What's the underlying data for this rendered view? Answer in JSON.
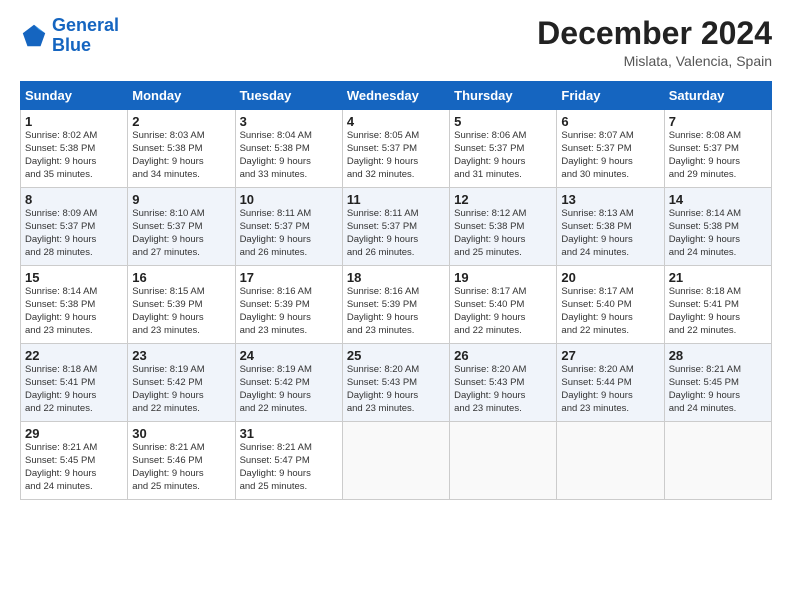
{
  "header": {
    "logo_line1": "General",
    "logo_line2": "Blue",
    "month_title": "December 2024",
    "location": "Mislata, Valencia, Spain"
  },
  "calendar": {
    "days_of_week": [
      "Sunday",
      "Monday",
      "Tuesday",
      "Wednesday",
      "Thursday",
      "Friday",
      "Saturday"
    ],
    "weeks": [
      [
        {
          "day": "",
          "info": ""
        },
        {
          "day": "2",
          "info": "Sunrise: 8:03 AM\nSunset: 5:38 PM\nDaylight: 9 hours\nand 34 minutes."
        },
        {
          "day": "3",
          "info": "Sunrise: 8:04 AM\nSunset: 5:38 PM\nDaylight: 9 hours\nand 33 minutes."
        },
        {
          "day": "4",
          "info": "Sunrise: 8:05 AM\nSunset: 5:37 PM\nDaylight: 9 hours\nand 32 minutes."
        },
        {
          "day": "5",
          "info": "Sunrise: 8:06 AM\nSunset: 5:37 PM\nDaylight: 9 hours\nand 31 minutes."
        },
        {
          "day": "6",
          "info": "Sunrise: 8:07 AM\nSunset: 5:37 PM\nDaylight: 9 hours\nand 30 minutes."
        },
        {
          "day": "7",
          "info": "Sunrise: 8:08 AM\nSunset: 5:37 PM\nDaylight: 9 hours\nand 29 minutes."
        }
      ],
      [
        {
          "day": "8",
          "info": "Sunrise: 8:09 AM\nSunset: 5:37 PM\nDaylight: 9 hours\nand 28 minutes."
        },
        {
          "day": "9",
          "info": "Sunrise: 8:10 AM\nSunset: 5:37 PM\nDaylight: 9 hours\nand 27 minutes."
        },
        {
          "day": "10",
          "info": "Sunrise: 8:11 AM\nSunset: 5:37 PM\nDaylight: 9 hours\nand 26 minutes."
        },
        {
          "day": "11",
          "info": "Sunrise: 8:11 AM\nSunset: 5:37 PM\nDaylight: 9 hours\nand 26 minutes."
        },
        {
          "day": "12",
          "info": "Sunrise: 8:12 AM\nSunset: 5:38 PM\nDaylight: 9 hours\nand 25 minutes."
        },
        {
          "day": "13",
          "info": "Sunrise: 8:13 AM\nSunset: 5:38 PM\nDaylight: 9 hours\nand 24 minutes."
        },
        {
          "day": "14",
          "info": "Sunrise: 8:14 AM\nSunset: 5:38 PM\nDaylight: 9 hours\nand 24 minutes."
        }
      ],
      [
        {
          "day": "15",
          "info": "Sunrise: 8:14 AM\nSunset: 5:38 PM\nDaylight: 9 hours\nand 23 minutes."
        },
        {
          "day": "16",
          "info": "Sunrise: 8:15 AM\nSunset: 5:39 PM\nDaylight: 9 hours\nand 23 minutes."
        },
        {
          "day": "17",
          "info": "Sunrise: 8:16 AM\nSunset: 5:39 PM\nDaylight: 9 hours\nand 23 minutes."
        },
        {
          "day": "18",
          "info": "Sunrise: 8:16 AM\nSunset: 5:39 PM\nDaylight: 9 hours\nand 23 minutes."
        },
        {
          "day": "19",
          "info": "Sunrise: 8:17 AM\nSunset: 5:40 PM\nDaylight: 9 hours\nand 22 minutes."
        },
        {
          "day": "20",
          "info": "Sunrise: 8:17 AM\nSunset: 5:40 PM\nDaylight: 9 hours\nand 22 minutes."
        },
        {
          "day": "21",
          "info": "Sunrise: 8:18 AM\nSunset: 5:41 PM\nDaylight: 9 hours\nand 22 minutes."
        }
      ],
      [
        {
          "day": "22",
          "info": "Sunrise: 8:18 AM\nSunset: 5:41 PM\nDaylight: 9 hours\nand 22 minutes."
        },
        {
          "day": "23",
          "info": "Sunrise: 8:19 AM\nSunset: 5:42 PM\nDaylight: 9 hours\nand 22 minutes."
        },
        {
          "day": "24",
          "info": "Sunrise: 8:19 AM\nSunset: 5:42 PM\nDaylight: 9 hours\nand 22 minutes."
        },
        {
          "day": "25",
          "info": "Sunrise: 8:20 AM\nSunset: 5:43 PM\nDaylight: 9 hours\nand 23 minutes."
        },
        {
          "day": "26",
          "info": "Sunrise: 8:20 AM\nSunset: 5:43 PM\nDaylight: 9 hours\nand 23 minutes."
        },
        {
          "day": "27",
          "info": "Sunrise: 8:20 AM\nSunset: 5:44 PM\nDaylight: 9 hours\nand 23 minutes."
        },
        {
          "day": "28",
          "info": "Sunrise: 8:21 AM\nSunset: 5:45 PM\nDaylight: 9 hours\nand 24 minutes."
        }
      ],
      [
        {
          "day": "29",
          "info": "Sunrise: 8:21 AM\nSunset: 5:45 PM\nDaylight: 9 hours\nand 24 minutes."
        },
        {
          "day": "30",
          "info": "Sunrise: 8:21 AM\nSunset: 5:46 PM\nDaylight: 9 hours\nand 25 minutes."
        },
        {
          "day": "31",
          "info": "Sunrise: 8:21 AM\nSunset: 5:47 PM\nDaylight: 9 hours\nand 25 minutes."
        },
        {
          "day": "",
          "info": ""
        },
        {
          "day": "",
          "info": ""
        },
        {
          "day": "",
          "info": ""
        },
        {
          "day": "",
          "info": ""
        }
      ]
    ],
    "day1_info": "Sunrise: 8:02 AM\nSunset: 5:38 PM\nDaylight: 9 hours\nand 35 minutes."
  }
}
